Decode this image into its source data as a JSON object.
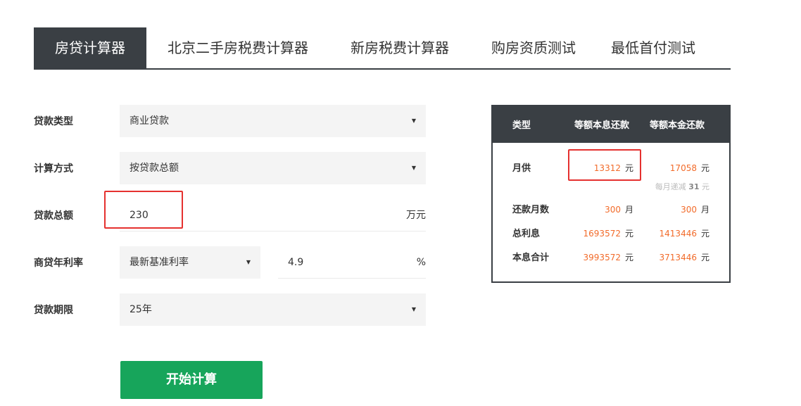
{
  "tabs": [
    {
      "label": "房贷计算器",
      "active": true
    },
    {
      "label": "北京二手房税费计算器",
      "active": false
    },
    {
      "label": "新房税费计算器",
      "active": false
    },
    {
      "label": "购房资质测试",
      "active": false
    },
    {
      "label": "最低首付测试",
      "active": false
    }
  ],
  "form": {
    "loan_type": {
      "label": "贷款类型",
      "value": "商业贷款"
    },
    "calc_method": {
      "label": "计算方式",
      "value": "按贷款总额"
    },
    "loan_amount": {
      "label": "贷款总额",
      "value": "230",
      "unit": "万元"
    },
    "rate": {
      "label": "商贷年利率",
      "option": "最新基准利率",
      "value": "4.9",
      "unit": "%"
    },
    "term": {
      "label": "贷款期限",
      "value": "25年"
    },
    "submit_label": "开始计算"
  },
  "icons": {
    "caret": "caret-down-icon"
  },
  "colors": {
    "dark": "#3a3f44",
    "accent": "#f26b2a",
    "button": "#17a55b",
    "highlight": "#e5312f"
  },
  "result": {
    "headers": [
      "类型",
      "等额本息还款",
      "等额本金还款"
    ],
    "monthly": {
      "label": "月供",
      "equal_payment": "13312",
      "equal_principal": "17058",
      "unit": "元",
      "decrease_prefix": "每月递减",
      "decrease_value": "31",
      "decrease_unit": "元"
    },
    "months": {
      "label": "还款月数",
      "equal_payment": "300",
      "equal_principal": "300",
      "unit": "月"
    },
    "interest": {
      "label": "总利息",
      "equal_payment": "1693572",
      "equal_principal": "1413446",
      "unit": "元"
    },
    "total": {
      "label": "本息合计",
      "equal_payment": "3993572",
      "equal_principal": "3713446",
      "unit": "元"
    }
  }
}
